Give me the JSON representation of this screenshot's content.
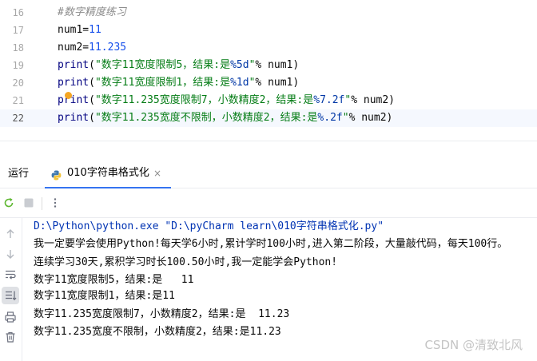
{
  "editor": {
    "lines": [
      {
        "no": "16",
        "segments": [
          {
            "t": "#数字精度练习",
            "c": "comment"
          }
        ]
      },
      {
        "no": "17",
        "segments": [
          {
            "t": "num1=",
            "c": ""
          },
          {
            "t": "11",
            "c": "num"
          }
        ]
      },
      {
        "no": "18",
        "segments": [
          {
            "t": "num2=",
            "c": ""
          },
          {
            "t": "11.235",
            "c": "num"
          }
        ]
      },
      {
        "no": "19",
        "segments": [
          {
            "t": "print",
            "c": "builtin"
          },
          {
            "t": "(",
            "c": ""
          },
          {
            "t": "\"数字11宽度限制5，结果:是",
            "c": "str"
          },
          {
            "t": "%5d",
            "c": "fmt"
          },
          {
            "t": "\"",
            "c": "str"
          },
          {
            "t": "% num1)",
            "c": ""
          }
        ]
      },
      {
        "no": "20",
        "segments": [
          {
            "t": "print",
            "c": "builtin"
          },
          {
            "t": "(",
            "c": ""
          },
          {
            "t": "\"数字11宽度限制1，结果:是",
            "c": "str"
          },
          {
            "t": "%1d",
            "c": "fmt"
          },
          {
            "t": "\"",
            "c": "str"
          },
          {
            "t": "% num1)",
            "c": ""
          }
        ]
      },
      {
        "no": "21",
        "segments": [
          {
            "t": "print",
            "c": "builtin"
          },
          {
            "t": "(",
            "c": ""
          },
          {
            "t": "\"数字11.235宽度限制7，小数精度2，结果:是",
            "c": "str"
          },
          {
            "t": "%7.2f",
            "c": "fmt"
          },
          {
            "t": "\"",
            "c": "str"
          },
          {
            "t": "% num2)",
            "c": ""
          }
        ]
      },
      {
        "no": "22",
        "segments": [
          {
            "t": "print",
            "c": "builtin"
          },
          {
            "t": "(",
            "c": ""
          },
          {
            "t": "\"数字11.235宽度不限制，小数精度2，结果:是",
            "c": "str"
          },
          {
            "t": "%.2f",
            "c": "fmt"
          },
          {
            "t": "\"",
            "c": "str"
          },
          {
            "t": "% num2)",
            "c": ""
          }
        ]
      }
    ],
    "current_line": "22"
  },
  "run_panel": {
    "title": "运行",
    "tab_label": "010字符串格式化",
    "tab_close": "×"
  },
  "console": {
    "lines": [
      "D:\\Python\\python.exe \"D:\\pyCharm learn\\010字符串格式化.py\"",
      "我一定要学会使用Python!每天学6小时,累计学时100小时,进入第二阶段，大量敲代码，每天100行。",
      "连续学习30天,累积学习时长100.50小时,我一定能学会Python!",
      "数字11宽度限制5，结果:是   11",
      "数字11宽度限制1，结果:是11",
      "数字11.235宽度限制7，小数精度2，结果:是  11.23",
      "数字11.235宽度不限制，小数精度2，结果:是11.23"
    ]
  },
  "watermark": "CSDN @清致北风",
  "colors": {
    "accent": "#3574f0",
    "string": "#067d17",
    "number": "#1750eb",
    "comment": "#8c8c8c"
  },
  "icons": {
    "toolbar": [
      "rerun-icon",
      "stop-icon",
      "more-icon"
    ],
    "side": [
      "scroll-up-icon",
      "scroll-down-icon",
      "soft-wrap-icon",
      "scroll-to-end-icon",
      "print-icon",
      "clear-icon"
    ]
  }
}
